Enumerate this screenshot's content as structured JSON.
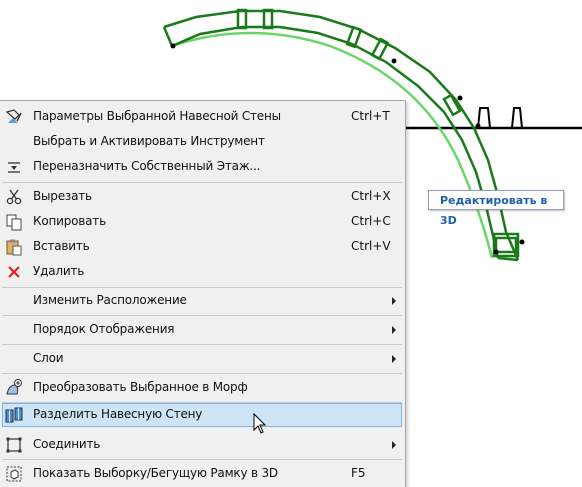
{
  "tooltip": {
    "text": "Редактировать в 3D"
  },
  "colors": {
    "wall_dark": "#1a7a1a",
    "wall_light": "#6ad66a",
    "highlight": "#cde5f7",
    "delete_red": "#e02020"
  },
  "menu": {
    "items": [
      {
        "label": "Параметры Выбранной Навесной Стены",
        "shortcut": "Ctrl+T",
        "icon": "curtain-wall-settings-icon"
      },
      {
        "label": "Выбрать и Активировать Инструмент",
        "shortcut": "",
        "icon": ""
      },
      {
        "label": "Переназначить Собственный Этаж...",
        "shortcut": "",
        "icon": "story-reassign-icon"
      },
      {
        "label": "Вырезать",
        "shortcut": "Ctrl+X",
        "icon": "scissors-icon"
      },
      {
        "label": "Копировать",
        "shortcut": "Ctrl+C",
        "icon": "copy-icon"
      },
      {
        "label": "Вставить",
        "shortcut": "Ctrl+V",
        "icon": "paste-icon"
      },
      {
        "label": "Удалить",
        "shortcut": "",
        "icon": "delete-icon"
      },
      {
        "label": "Изменить Расположение",
        "submenu": true
      },
      {
        "label": "Порядок Отображения",
        "submenu": true
      },
      {
        "label": "Слои",
        "submenu": true
      },
      {
        "label": "Преобразовать Выбранное в Морф",
        "icon": "morph-convert-icon"
      },
      {
        "label": "Разделить Навесную Стену",
        "icon": "split-curtain-wall-icon",
        "highlighted": true
      },
      {
        "label": "Соединить",
        "icon": "connect-icon",
        "submenu": true
      },
      {
        "label": "Показать Выборку/Бегущую Рамку в 3D",
        "shortcut": "F5",
        "icon": "show-in-3d-icon"
      }
    ]
  }
}
